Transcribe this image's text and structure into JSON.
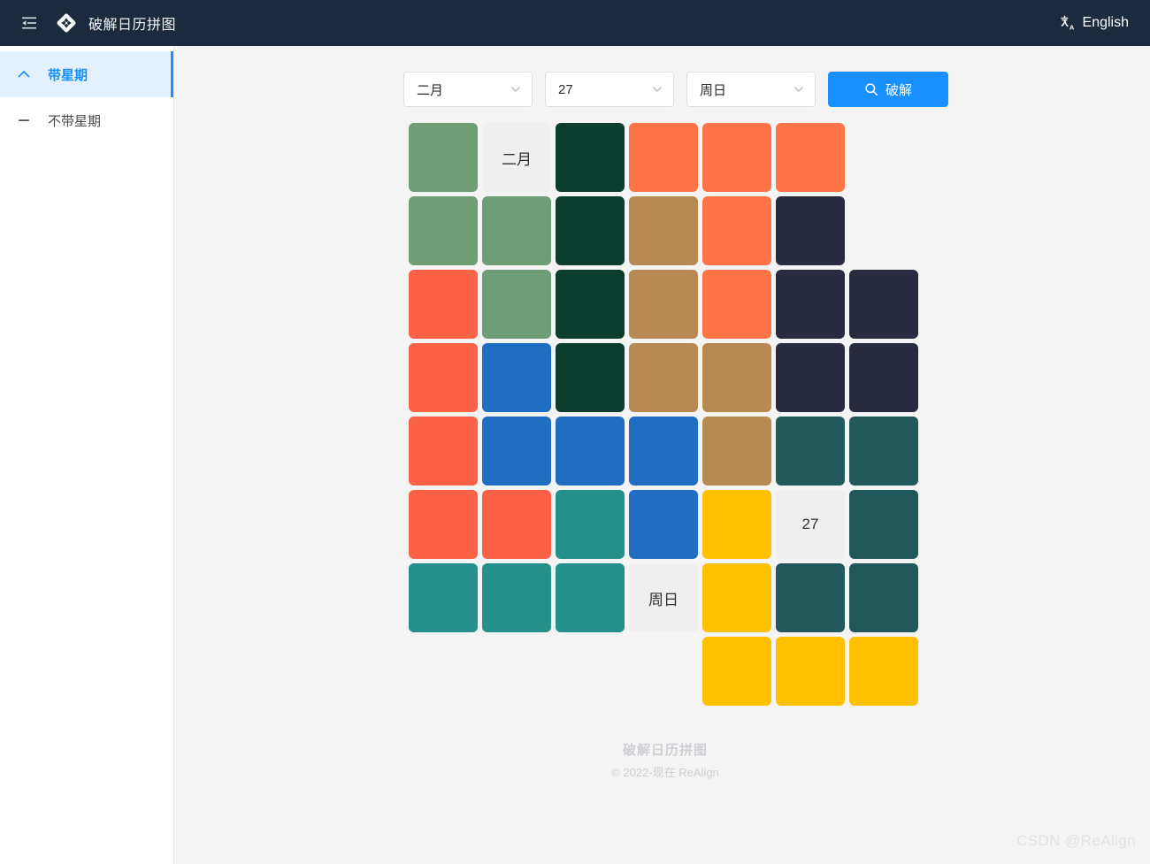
{
  "header": {
    "menu_icon": "menu-fold-icon",
    "logo_icon": "diamond-logo-icon",
    "title": "破解日历拼图",
    "language": {
      "icon": "translate-icon",
      "label": "English"
    }
  },
  "sidebar": {
    "items": [
      {
        "label": "带星期",
        "icon": "chevron-up-icon",
        "active": true
      },
      {
        "label": "不带星期",
        "icon": "minus-icon",
        "active": false
      }
    ]
  },
  "toolbar": {
    "month_select": {
      "value": "二月",
      "icon": "chevron-down-icon"
    },
    "day_select": {
      "value": "27",
      "icon": "chevron-down-icon"
    },
    "weekday_select": {
      "value": "周日",
      "icon": "chevron-down-icon"
    },
    "solve_button": {
      "label": "破解",
      "icon": "search-icon",
      "color": "#1890ff"
    }
  },
  "board": {
    "columns": 7,
    "rows": 8,
    "palette": {
      "sage_green": "#6f9e76",
      "dark_green": "#0d3d2e",
      "orange": "#ff7446",
      "orange_red": "#fb6245",
      "tan": "#b78a53",
      "navy": "#282a40",
      "blue": "#1f6ec2",
      "dark_teal": "#21595a",
      "teal": "#25908a",
      "yellow": "#ffc000",
      "label_bg": "#efefef",
      "empty": "transparent"
    },
    "cells": [
      [
        {
          "c": "sage_green"
        },
        {
          "c": "label_bg",
          "t": "二月"
        },
        {
          "c": "dark_green"
        },
        {
          "c": "orange"
        },
        {
          "c": "orange"
        },
        {
          "c": "orange"
        },
        {
          "c": "empty"
        }
      ],
      [
        {
          "c": "sage_green"
        },
        {
          "c": "sage_green"
        },
        {
          "c": "dark_green"
        },
        {
          "c": "tan"
        },
        {
          "c": "orange"
        },
        {
          "c": "navy"
        },
        {
          "c": "empty"
        }
      ],
      [
        {
          "c": "orange_red"
        },
        {
          "c": "sage_green"
        },
        {
          "c": "dark_green"
        },
        {
          "c": "tan"
        },
        {
          "c": "orange"
        },
        {
          "c": "navy"
        },
        {
          "c": "navy"
        }
      ],
      [
        {
          "c": "orange_red"
        },
        {
          "c": "blue"
        },
        {
          "c": "dark_green"
        },
        {
          "c": "tan"
        },
        {
          "c": "tan"
        },
        {
          "c": "navy"
        },
        {
          "c": "navy"
        }
      ],
      [
        {
          "c": "orange_red"
        },
        {
          "c": "blue"
        },
        {
          "c": "blue"
        },
        {
          "c": "blue"
        },
        {
          "c": "tan"
        },
        {
          "c": "dark_teal"
        },
        {
          "c": "dark_teal"
        }
      ],
      [
        {
          "c": "orange_red"
        },
        {
          "c": "orange_red"
        },
        {
          "c": "teal"
        },
        {
          "c": "blue"
        },
        {
          "c": "yellow"
        },
        {
          "c": "label_bg",
          "t": "27"
        },
        {
          "c": "dark_teal"
        }
      ],
      [
        {
          "c": "teal"
        },
        {
          "c": "teal"
        },
        {
          "c": "teal"
        },
        {
          "c": "label_bg",
          "t": "周日"
        },
        {
          "c": "yellow"
        },
        {
          "c": "dark_teal"
        },
        {
          "c": "dark_teal"
        }
      ],
      [
        {
          "c": "empty"
        },
        {
          "c": "empty"
        },
        {
          "c": "empty"
        },
        {
          "c": "empty"
        },
        {
          "c": "yellow"
        },
        {
          "c": "yellow"
        },
        {
          "c": "yellow"
        }
      ]
    ]
  },
  "footer": {
    "title": "破解日历拼图",
    "copyright": "© 2022-现在 ReAlign"
  },
  "watermark": "CSDN @ReAlign"
}
